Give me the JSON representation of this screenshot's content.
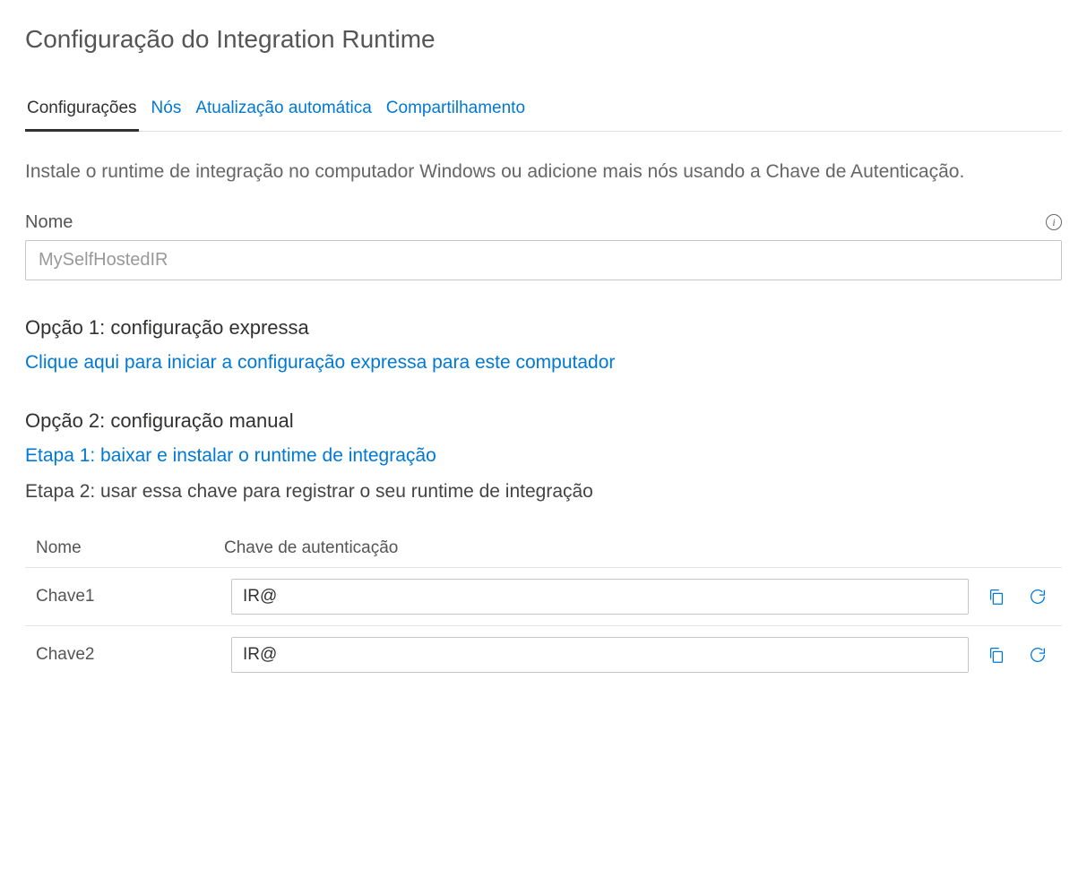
{
  "page": {
    "title": "Configuração do Integration Runtime"
  },
  "tabs": {
    "items": [
      {
        "label": "Configurações",
        "active": true
      },
      {
        "label": "Nós",
        "active": false
      },
      {
        "label": "Atualização automática",
        "active": false
      },
      {
        "label": "Compartilhamento",
        "active": false
      }
    ]
  },
  "description": "Instale o runtime de integração no computador Windows ou adicione mais nós usando a Chave de Autenticação.",
  "nameField": {
    "label": "Nome",
    "value": "MySelfHostedIR"
  },
  "option1": {
    "heading": "Opção 1: configuração expressa",
    "link": "Clique aqui para iniciar a configuração expressa para este computador"
  },
  "option2": {
    "heading": "Opção 2: configuração manual",
    "step1_link": "Etapa 1: baixar e instalar o runtime de integração",
    "step2_text": "Etapa 2: usar essa chave para registrar o seu runtime de integração"
  },
  "keyTable": {
    "headers": {
      "name": "Nome",
      "key": "Chave de autenticação"
    },
    "rows": [
      {
        "name": "Chave1",
        "value": "IR@"
      },
      {
        "name": "Chave2",
        "value": "IR@"
      }
    ]
  }
}
